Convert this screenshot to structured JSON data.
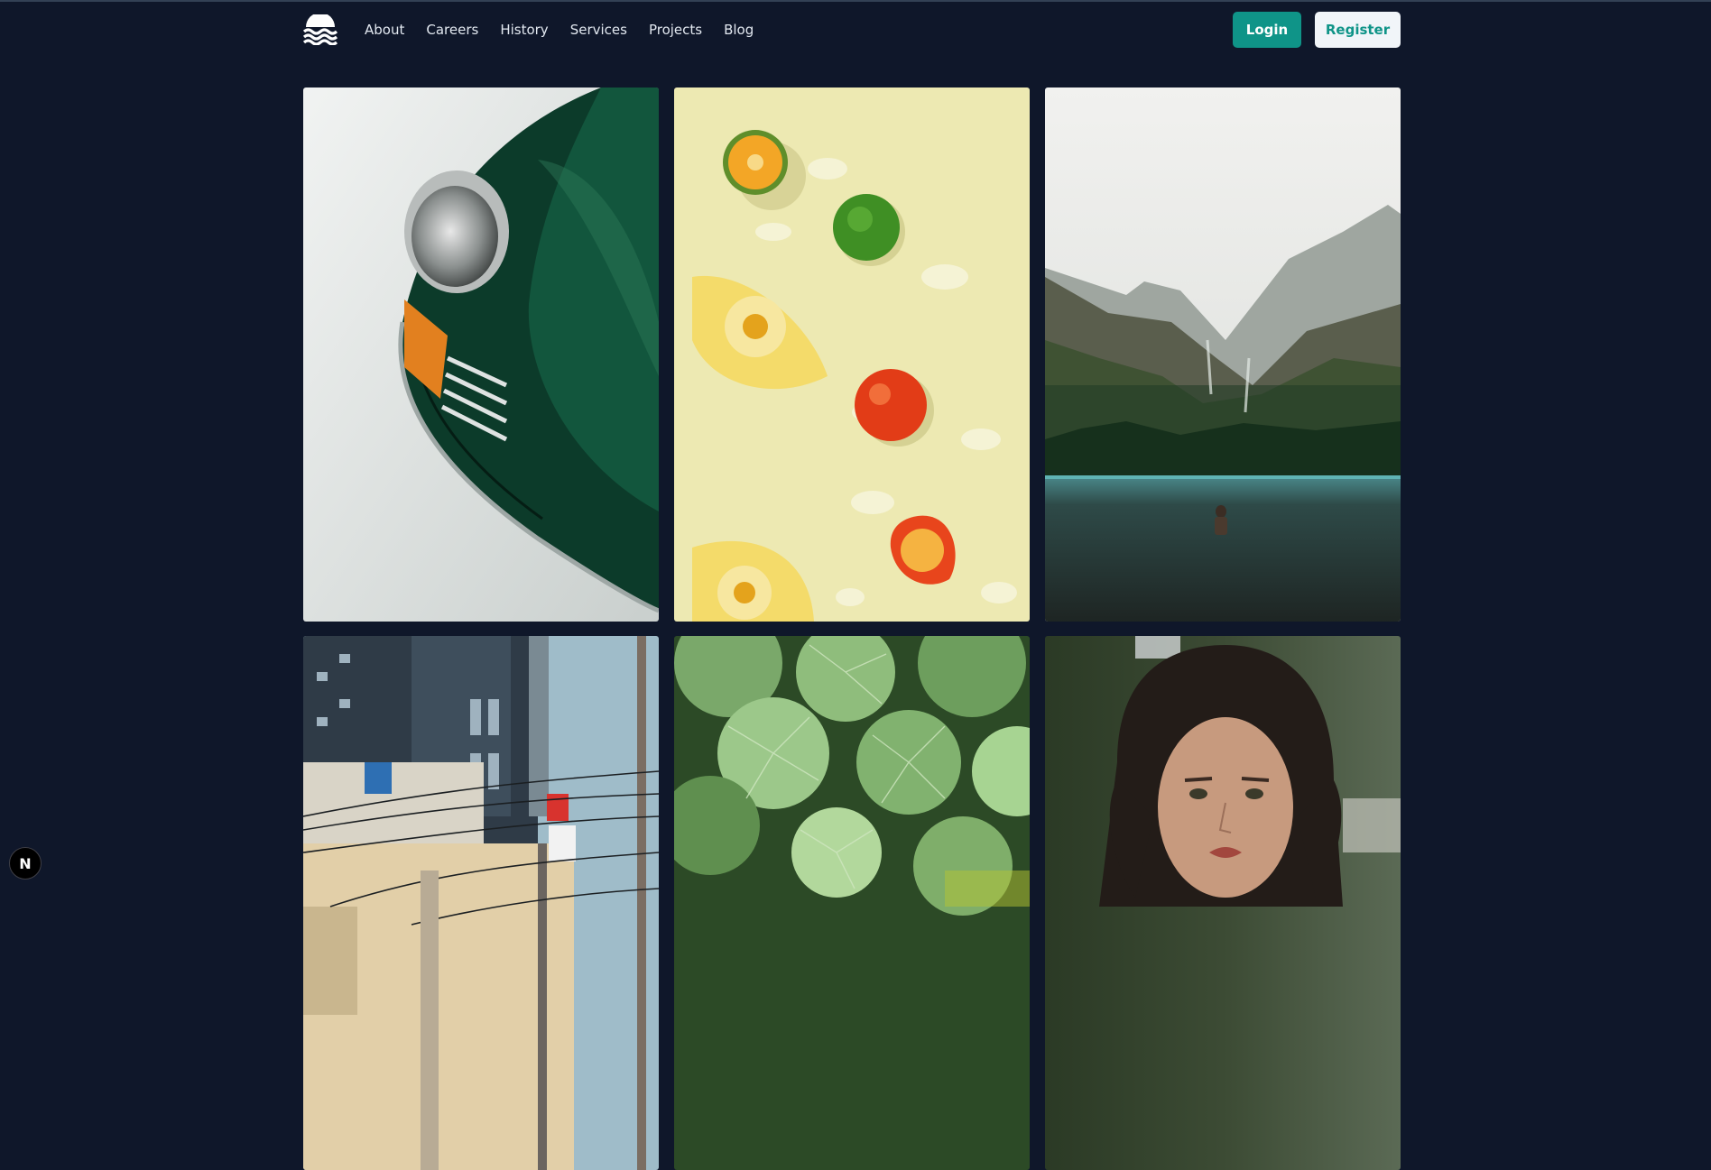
{
  "header": {
    "logo_icon": "waves-logo-icon",
    "nav": [
      {
        "label": "About"
      },
      {
        "label": "Careers"
      },
      {
        "label": "History"
      },
      {
        "label": "Services"
      },
      {
        "label": "Projects"
      },
      {
        "label": "Blog"
      }
    ],
    "login_label": "Login",
    "register_label": "Register"
  },
  "gallery": {
    "photos": [
      {
        "subject": "green-vintage-car-headlight"
      },
      {
        "subject": "citrus-fruits-on-yellow"
      },
      {
        "subject": "mountain-lake-swimmer"
      },
      {
        "subject": "city-street-power-lines"
      },
      {
        "subject": "green-nasturtium-leaves"
      },
      {
        "subject": "woman-portrait"
      }
    ]
  },
  "dev_badge": {
    "label": "N"
  },
  "colors": {
    "background": "#0f172a",
    "accent": "#0f9488",
    "register_bg": "#f1f5f9",
    "nav_text": "#e2e8f0"
  }
}
